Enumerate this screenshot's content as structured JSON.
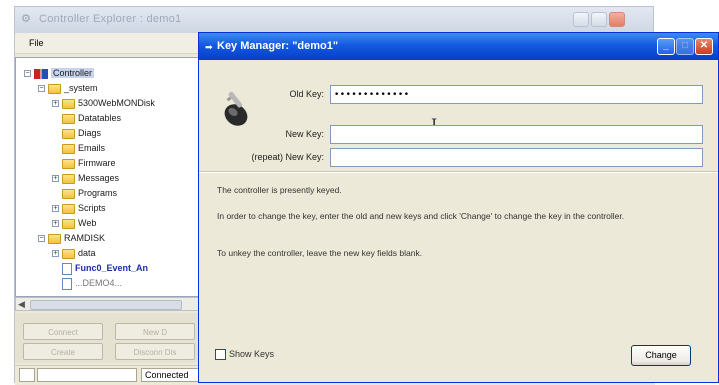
{
  "background_window": {
    "title": "Controller Explorer : demo1",
    "menu": {
      "file": "File"
    },
    "tree": [
      {
        "label": "Controller",
        "expander": "-",
        "icon": "controller",
        "selected": true
      },
      {
        "label": "_system",
        "expander": "-",
        "icon": "folder"
      },
      {
        "label": "5300WebMONDisk",
        "expander": "+",
        "icon": "folder"
      },
      {
        "label": "Datatables",
        "expander": "",
        "icon": "folder"
      },
      {
        "label": "Diags",
        "expander": "",
        "icon": "folder"
      },
      {
        "label": "Emails",
        "expander": "",
        "icon": "folder"
      },
      {
        "label": "Firmware",
        "expander": "",
        "icon": "folder"
      },
      {
        "label": "Messages",
        "expander": "+",
        "icon": "folder"
      },
      {
        "label": "Programs",
        "expander": "",
        "icon": "folder"
      },
      {
        "label": "Scripts",
        "expander": "+",
        "icon": "folder"
      },
      {
        "label": "Web",
        "expander": "+",
        "icon": "folder"
      },
      {
        "label": "RAMDISK",
        "expander": "-",
        "icon": "folder"
      },
      {
        "label": "data",
        "expander": "+",
        "icon": "folder"
      },
      {
        "label": "Func0_Event_An",
        "expander": "",
        "icon": "file",
        "bold": true
      },
      {
        "label": "...DEMO4...",
        "expander": "",
        "icon": "file"
      }
    ],
    "toolbar": {
      "connect": "Connect",
      "new": "New D",
      "create": "Create",
      "disconnect": "Disconn Dis"
    },
    "status": {
      "connection": "Connected"
    }
  },
  "dialog": {
    "title": "Key Manager: \"demo1\"",
    "key_icon": "key-icon",
    "fields": {
      "old_key_label": "Old Key:",
      "old_key_value": "•••••••••••••",
      "new_key_label": "New Key:",
      "new_key_value": "",
      "repeat_key_label": "(repeat) New Key:",
      "repeat_key_value": ""
    },
    "info": {
      "line1": "The controller is presently keyed.",
      "line2": "In order to change the key, enter the old and new keys and click 'Change' to change the key in the controller.",
      "line3": "To unkey the controller, leave the new key fields blank."
    },
    "show_keys_label": "Show Keys",
    "change_button": "Change",
    "colors": {
      "titlebar": "#0a46d0",
      "dialog_bg": "#ece9d8"
    }
  }
}
